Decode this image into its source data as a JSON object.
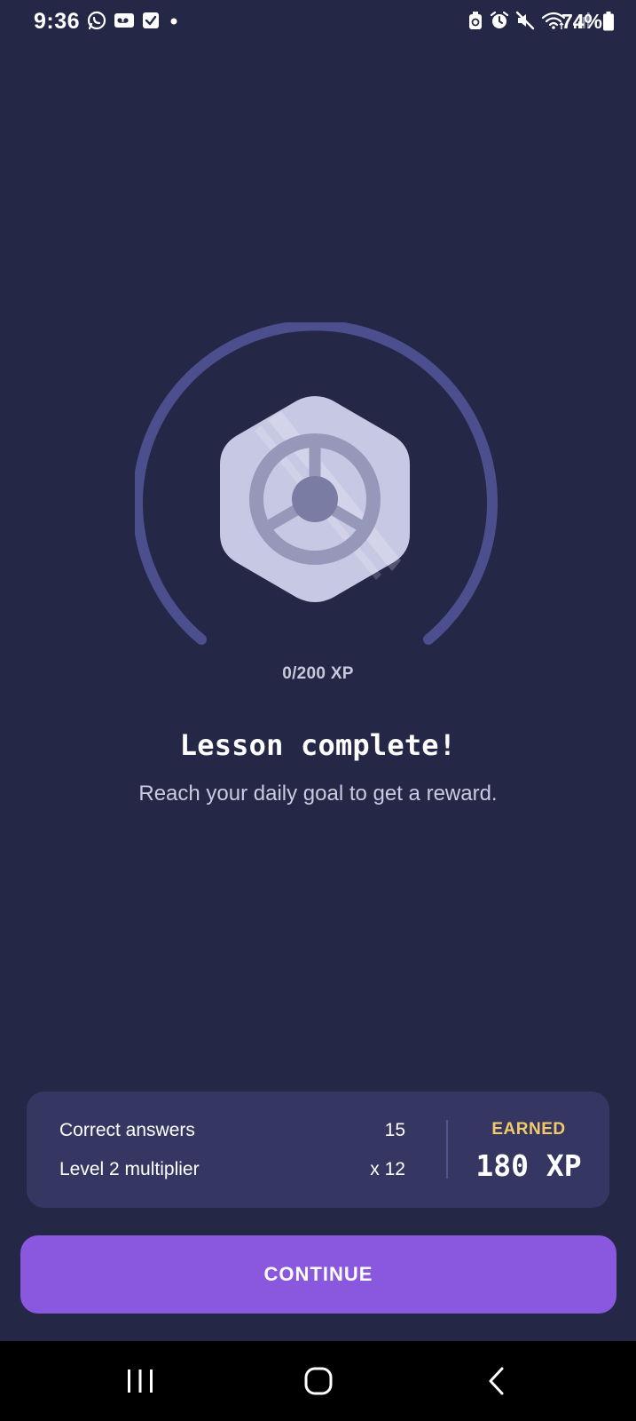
{
  "status_bar": {
    "time": "9:36",
    "battery": "74%",
    "left_icons": [
      "whatsapp-icon",
      "voicemail-icon",
      "task-check-icon",
      "dot-icon"
    ],
    "right_icons": [
      "battery-saver-icon",
      "alarm-icon",
      "mute-icon",
      "wifi-icon",
      "signal-icon",
      "battery-icon"
    ]
  },
  "badge": {
    "icon": "steering-wheel-icon",
    "progress_fraction": 0,
    "colors": {
      "ring": "#4c4f8e",
      "badge_fill": "#c7c8e3",
      "wheel": "#9698b9",
      "hub": "#7a7ca3"
    }
  },
  "xp_progress": "0/200 XP",
  "title": "Lesson complete!",
  "subtitle": "Reach your daily goal to get a reward.",
  "summary": {
    "rows": [
      {
        "label": "Correct answers",
        "value": "15"
      },
      {
        "label": "Level 2 multiplier",
        "value": "x 12"
      }
    ],
    "earned_label": "EARNED",
    "earned_value": "180 XP"
  },
  "continue_label": "CONTINUE",
  "nav": {
    "recents": "recents-icon",
    "home": "home-icon",
    "back": "back-icon"
  },
  "colors": {
    "background": "#252746",
    "card": "#353762",
    "accent": "#8a58df",
    "earned": "#f3c96a"
  }
}
